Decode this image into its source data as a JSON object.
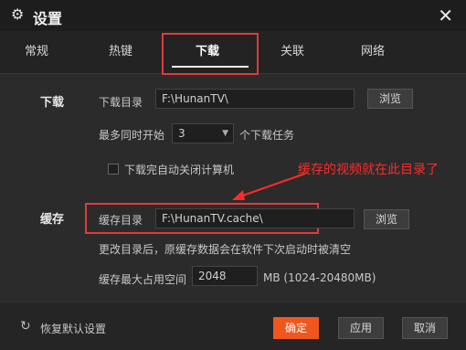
{
  "window": {
    "title": "设置",
    "close_glyph": "✕",
    "gear_glyph": "⚙"
  },
  "tabs": [
    {
      "label": "常规"
    },
    {
      "label": "热键"
    },
    {
      "label": "下载"
    },
    {
      "label": "关联"
    },
    {
      "label": "网络"
    }
  ],
  "active_tab": "下载",
  "download": {
    "section_label": "下载",
    "dir_label": "下载目录",
    "dir_value": "F:\\HunanTV\\",
    "browse_label": "浏览",
    "max_tasks_prefix": "最多同时开始",
    "max_tasks_value": "3",
    "max_tasks_suffix": "个下载任务",
    "shutdown_label": "下载完自动关闭计算机"
  },
  "cache": {
    "section_label": "缓存",
    "dir_label": "缓存目录",
    "dir_value": "F:\\HunanTV.cache\\",
    "browse_label": "浏览",
    "note": "更改目录后，原缓存数据会在软件下次启动时被清空",
    "max_label": "缓存最大占用空间",
    "max_value": "2048",
    "max_unit": "MB (1024-20480MB)"
  },
  "annotation": {
    "text": "缓存的视频就在此目录了",
    "color": "#ff2a2a"
  },
  "footer": {
    "restore_label": "恢复默认设置",
    "ok_label": "确定",
    "apply_label": "应用",
    "cancel_label": "取消"
  },
  "colors": {
    "accent": "#f0571e",
    "highlight": "#e03b3b"
  }
}
